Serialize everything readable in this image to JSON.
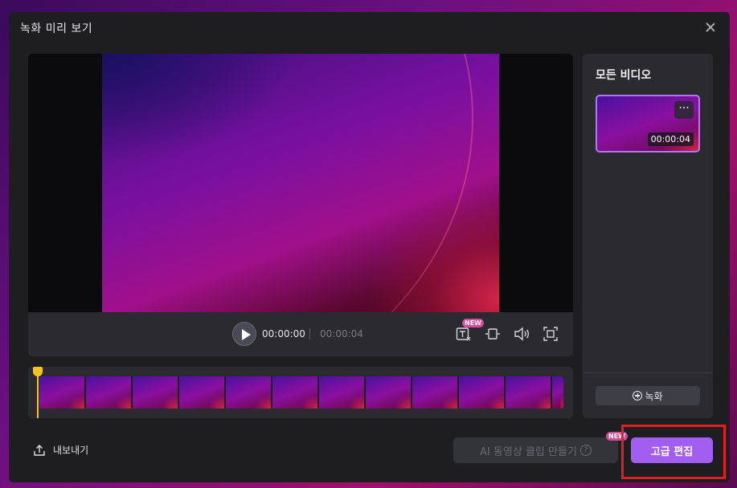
{
  "dialog": {
    "title": "녹화 미리 보기"
  },
  "player": {
    "current_time": "00:00:00",
    "duration": "00:00:04",
    "new_badge": "NEW"
  },
  "side_panel": {
    "title": "모든 비디오",
    "video_duration": "00:00:04",
    "more_label": "···",
    "record_label": "녹화"
  },
  "footer": {
    "export_label": "내보내기",
    "ai_clip_label": "AI 동영상 클립 만들기",
    "ai_help": "?",
    "ai_new_badge": "NEW",
    "advanced_edit_label": "고급 편집"
  },
  "colors": {
    "accent": "#a15ef0",
    "playhead": "#f5c518",
    "badge": "#d94a9a",
    "highlight": "#e02020"
  },
  "icons": [
    "close-icon",
    "play-icon",
    "text-speech-icon",
    "crop-icon",
    "volume-icon",
    "fullscreen-icon",
    "plus-circle-icon",
    "export-icon",
    "help-icon"
  ]
}
